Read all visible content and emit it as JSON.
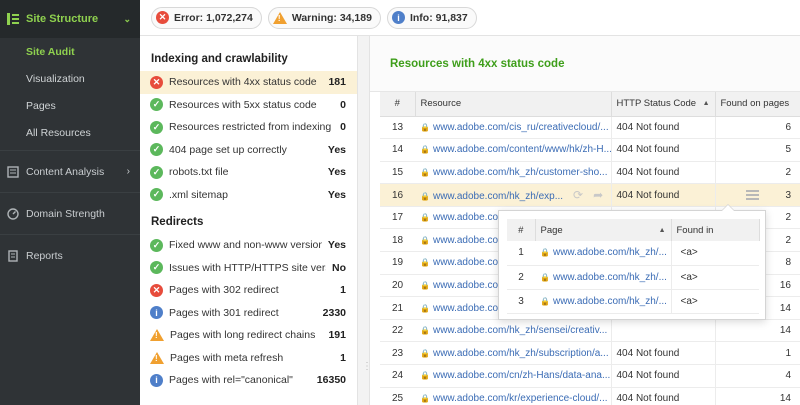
{
  "sidebar": {
    "head": "Site Structure",
    "sub_items": [
      {
        "label": "Site Audit",
        "active": true
      },
      {
        "label": "Visualization",
        "active": false
      },
      {
        "label": "Pages",
        "active": false
      },
      {
        "label": "All Resources",
        "active": false
      }
    ],
    "sections": [
      {
        "label": "Content Analysis",
        "icon": "content-analysis-icon",
        "has_chevron": true
      },
      {
        "label": "Domain Strength",
        "icon": "gauge-icon",
        "has_chevron": false
      },
      {
        "label": "Reports",
        "icon": "reports-icon",
        "has_chevron": false
      }
    ]
  },
  "topbar": {
    "error": "Error: 1,072,274",
    "warning": "Warning: 34,189",
    "info": "Info: 91,837"
  },
  "indexing": {
    "heading": "Indexing and crawlability",
    "items": [
      {
        "status": "error",
        "label": "Resources with 4xx status code",
        "value": "181"
      },
      {
        "status": "ok",
        "label": "Resources with 5xx status code",
        "value": "0"
      },
      {
        "status": "ok",
        "label": "Resources restricted from indexing",
        "value": "0"
      },
      {
        "status": "ok",
        "label": "404 page set up correctly",
        "value": "Yes"
      },
      {
        "status": "ok",
        "label": "robots.txt file",
        "value": "Yes"
      },
      {
        "status": "ok",
        "label": ".xml sitemap",
        "value": "Yes"
      }
    ]
  },
  "redirects": {
    "heading": "Redirects",
    "items": [
      {
        "status": "ok",
        "label": "Fixed www and non-www versions",
        "value": "Yes"
      },
      {
        "status": "ok",
        "label": "Issues with HTTP/HTTPS site versions",
        "value": "No"
      },
      {
        "status": "error",
        "label": "Pages with 302 redirect",
        "value": "1"
      },
      {
        "status": "info",
        "label": "Pages with 301 redirect",
        "value": "2330"
      },
      {
        "status": "warning",
        "label": "Pages with long redirect chains",
        "value": "191"
      },
      {
        "status": "warning",
        "label": "Pages with meta refresh",
        "value": "1"
      },
      {
        "status": "info",
        "label": "Pages with rel=\"canonical\"",
        "value": "16350"
      }
    ]
  },
  "results": {
    "title": "Resources with 4xx status code",
    "columns": {
      "num": "#",
      "resource": "Resource",
      "http": "HTTP Status Code",
      "found": "Found on pages"
    },
    "rows": [
      {
        "num": "13",
        "resource": "www.adobe.com/cis_ru/creativecloud/...",
        "http": "404 Not found",
        "found": "6"
      },
      {
        "num": "14",
        "resource": "www.adobe.com/content/www/hk/zh-H...",
        "http": "404 Not found",
        "found": "5"
      },
      {
        "num": "15",
        "resource": "www.adobe.com/hk_zh/customer-sho...",
        "http": "404 Not found",
        "found": "2"
      },
      {
        "num": "16",
        "resource": "www.adobe.com/hk_zh/exp...",
        "http": "404 Not found",
        "found": "3"
      },
      {
        "num": "17",
        "resource": "www.adobe.com",
        "http": "",
        "found": "2"
      },
      {
        "num": "18",
        "resource": "www.adobe.com",
        "http": "",
        "found": "2"
      },
      {
        "num": "19",
        "resource": "www.adobe.com",
        "http": "",
        "found": "8"
      },
      {
        "num": "20",
        "resource": "www.adobe.com",
        "http": "",
        "found": "16"
      },
      {
        "num": "21",
        "resource": "www.adobe.com",
        "http": "",
        "found": "14"
      },
      {
        "num": "22",
        "resource": "www.adobe.com/hk_zh/sensei/creativ...",
        "http": "",
        "found": "14"
      },
      {
        "num": "23",
        "resource": "www.adobe.com/hk_zh/subscription/a...",
        "http": "404 Not found",
        "found": "1"
      },
      {
        "num": "24",
        "resource": "www.adobe.com/cn/zh-Hans/data-ana...",
        "http": "404 Not found",
        "found": "4"
      },
      {
        "num": "25",
        "resource": "www.adobe.com/kr/experience-cloud/...",
        "http": "404 Not found",
        "found": "14"
      }
    ]
  },
  "popup": {
    "columns": {
      "num": "#",
      "page": "Page",
      "found_in": "Found in"
    },
    "rows": [
      {
        "num": "1",
        "page": "www.adobe.com/hk_zh/...",
        "found_in": "<a>"
      },
      {
        "num": "2",
        "page": "www.adobe.com/hk_zh/...",
        "found_in": "<a>"
      },
      {
        "num": "3",
        "page": "www.adobe.com/hk_zh/...",
        "found_in": "<a>"
      }
    ]
  }
}
